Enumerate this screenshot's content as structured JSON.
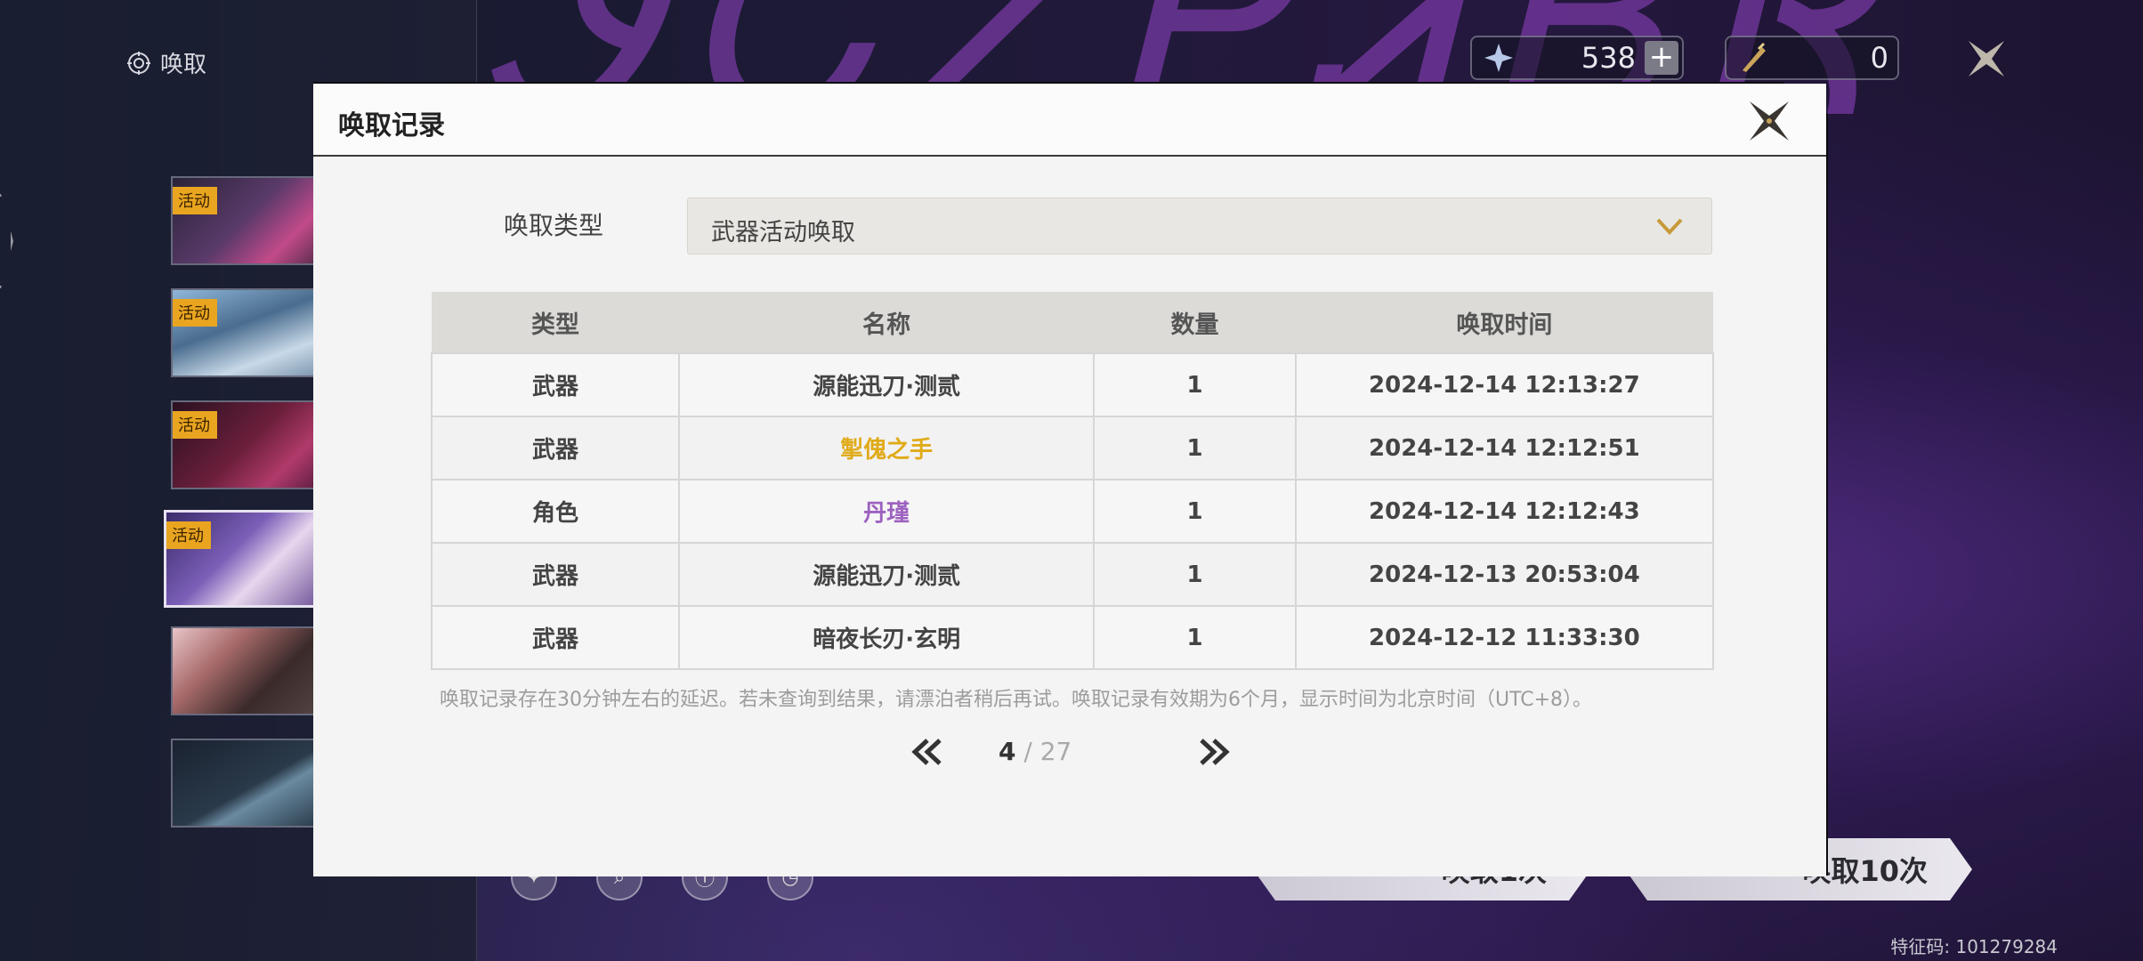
{
  "app": {
    "title": "唤取",
    "id_code": "特征码: 101279284"
  },
  "currency": {
    "astrite": "538",
    "tide": "0"
  },
  "banners": [
    {
      "tag": "活动"
    },
    {
      "tag": "活动"
    },
    {
      "tag": "活动"
    },
    {
      "tag": "活动"
    },
    {
      "tag": ""
    },
    {
      "tag": ""
    }
  ],
  "pull_buttons": {
    "one": "唤取1次",
    "ten": "唤取10次"
  },
  "modal": {
    "title": "唤取记录",
    "type_label": "唤取类型",
    "type_value": "武器活动唤取",
    "columns": [
      "类型",
      "名称",
      "数量",
      "唤取时间"
    ],
    "rows": [
      {
        "type": "武器",
        "name": "源能迅刀·测贰",
        "count": "1",
        "time": "2024-12-14 12:13:27",
        "rarity": "normal"
      },
      {
        "type": "武器",
        "name": "掣傀之手",
        "count": "1",
        "time": "2024-12-14 12:12:51",
        "rarity": "gold"
      },
      {
        "type": "角色",
        "name": "丹瑾",
        "count": "1",
        "time": "2024-12-14 12:12:43",
        "rarity": "purple"
      },
      {
        "type": "武器",
        "name": "源能迅刀·测贰",
        "count": "1",
        "time": "2024-12-13 20:53:04",
        "rarity": "normal"
      },
      {
        "type": "武器",
        "name": "暗夜长刃·玄明",
        "count": "1",
        "time": "2024-12-12 11:33:30",
        "rarity": "normal"
      }
    ],
    "note": "唤取记录存在30分钟左右的延迟。若未查询到结果，请漂泊者稍后再试。唤取记录有效期为6个月，显示时间为北京时间（UTC+8）。",
    "page": {
      "current": "4",
      "separator": "/",
      "total": "27"
    }
  },
  "colors": {
    "gold": "#e0ab19",
    "purple": "#9d62c0",
    "tag": "#e9a520"
  }
}
